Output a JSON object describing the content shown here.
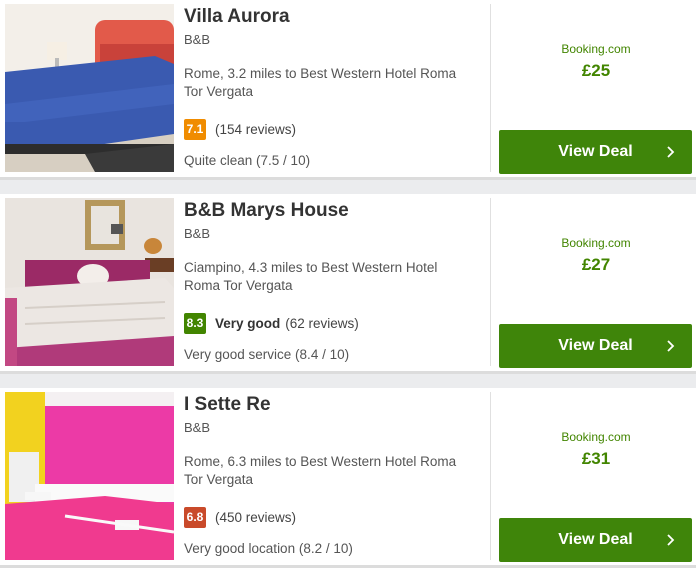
{
  "results": [
    {
      "name": "Villa Aurora",
      "type": "B&B",
      "location": "Rome, 3.2 miles to Best Western Hotel Roma Tor Vergata",
      "score": "7.1",
      "score_color": "#f08c00",
      "rating_label": "",
      "reviews": "(154 reviews)",
      "subscore": "Quite clean (7.5 / 10)",
      "provider": "Booking.com",
      "price": "£25",
      "button": "View Deal"
    },
    {
      "name": "B&B Marys House",
      "type": "B&B",
      "location": "Ciampino, 4.3 miles to Best Western Hotel Roma Tor Vergata",
      "score": "8.3",
      "score_color": "#428500",
      "rating_label": "Very good",
      "reviews": "(62 reviews)",
      "subscore": "Very good service (8.4 / 10)",
      "provider": "Booking.com",
      "price": "£27",
      "button": "View Deal"
    },
    {
      "name": "I Sette Re",
      "type": "B&B",
      "location": "Rome, 6.3 miles to Best Western Hotel Roma Tor Vergata",
      "score": "6.8",
      "score_color": "#c94a2a",
      "rating_label": "",
      "reviews": "(450 reviews)",
      "subscore": "Very good location (8.2 / 10)",
      "provider": "Booking.com",
      "price": "£31",
      "button": "View Deal"
    }
  ],
  "colors": {
    "deal_button": "#3f850a",
    "price_green": "#428500"
  },
  "icons": {
    "deal_arrow": "chevron-right-icon"
  }
}
